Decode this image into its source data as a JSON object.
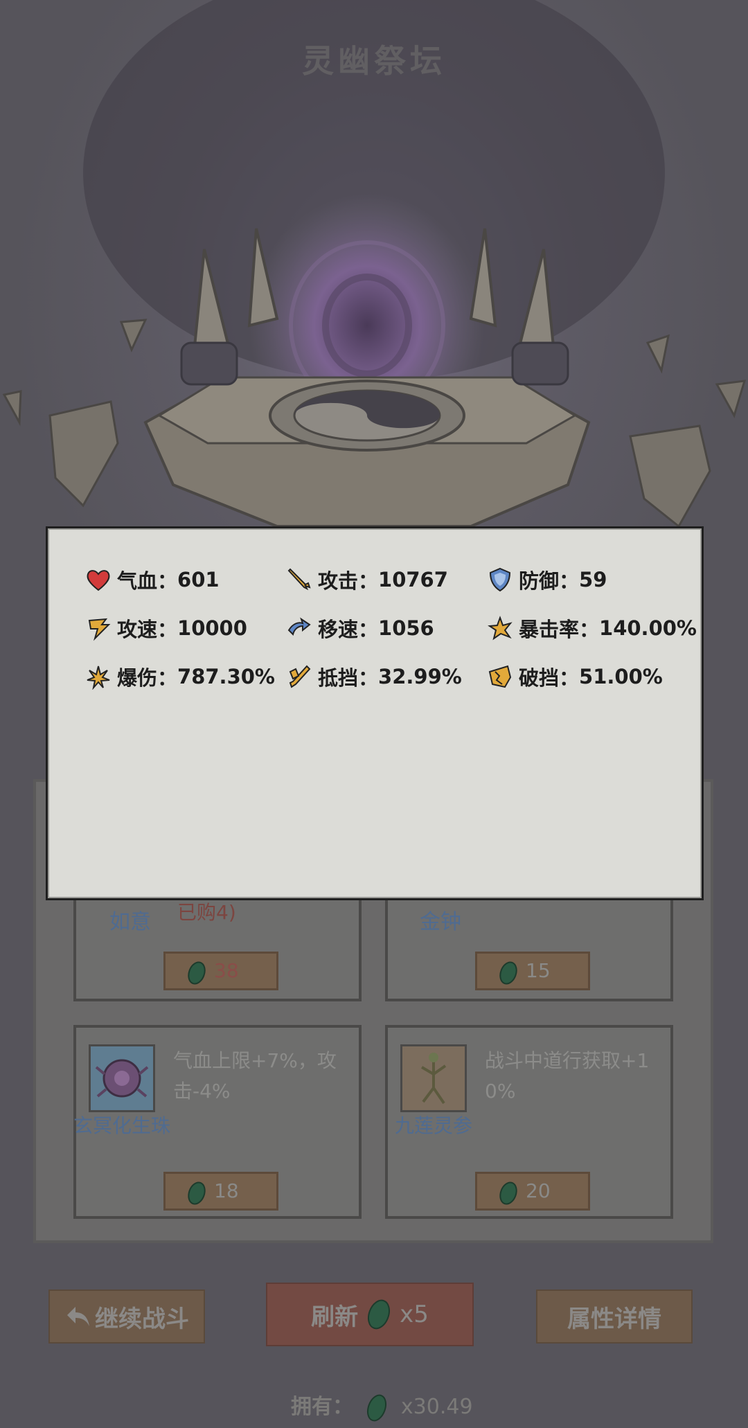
{
  "title": "灵幽祭坛",
  "stats": [
    {
      "icon": "heart-icon",
      "label": "气血：",
      "value": "601"
    },
    {
      "icon": "sword-icon",
      "label": "攻击：",
      "value": "10767"
    },
    {
      "icon": "shield-icon",
      "label": "防御：",
      "value": "59"
    },
    {
      "icon": "attack-speed-icon",
      "label": "攻速：",
      "value": "10000"
    },
    {
      "icon": "move-speed-icon",
      "label": "移速：",
      "value": "1056"
    },
    {
      "icon": "crit-rate-icon",
      "label": "暴击率：",
      "value": "140.00%"
    },
    {
      "icon": "crit-damage-icon",
      "label": "爆伤：",
      "value": "787.30%"
    },
    {
      "icon": "block-icon",
      "label": "抵挡：",
      "value": "32.99%"
    },
    {
      "icon": "break-block-icon",
      "label": "破挡：",
      "value": "51.00%"
    }
  ],
  "shop": {
    "top_cards": [
      {
        "name": "如意",
        "note": "已购4)",
        "price": "38"
      },
      {
        "name": "金钟",
        "note": "",
        "price": "15"
      }
    ],
    "cards": [
      {
        "name": "玄冥化生珠",
        "desc_line1": "气血上限+7%，攻",
        "desc_line2": "击-4%",
        "price": "18",
        "icon": "purple-orb-icon"
      },
      {
        "name": "九莲灵参",
        "desc_line1": "战斗中道行获取+1",
        "desc_line2": "0%",
        "price": "20",
        "icon": "ginseng-icon"
      }
    ]
  },
  "buttons": {
    "continue_label": "继续战斗",
    "refresh_label": "刷新",
    "refresh_cost": "x5",
    "attr_label": "属性详情"
  },
  "owned": {
    "label": "拥有：",
    "amount": "x30.49"
  },
  "colors": {
    "popup_bg": "#dcdcd7",
    "gem": "#2e7a4d",
    "icon_gold": "#e2a93a",
    "heart": "#d23b3b",
    "shield": "#5e86c4"
  }
}
